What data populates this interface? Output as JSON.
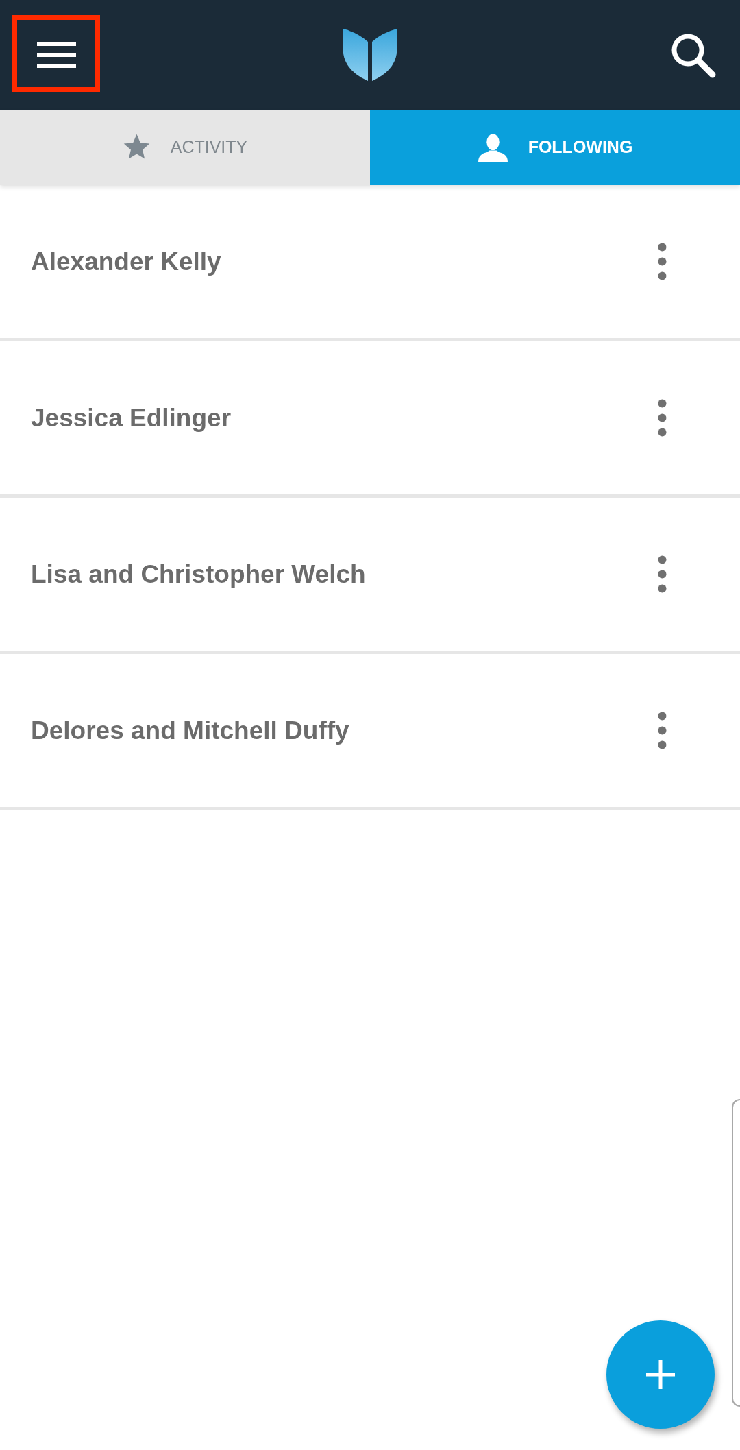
{
  "header": {
    "menu_button": {
      "highlighted": true
    }
  },
  "tabs": [
    {
      "label": "ACTIVITY",
      "selected": false
    },
    {
      "label": "FOLLOWING",
      "selected": true
    }
  ],
  "following": [
    {
      "name": "Alexander Kelly"
    },
    {
      "name": "Jessica Edlinger"
    },
    {
      "name": "Lisa and Christopher Welch"
    },
    {
      "name": "Delores and Mitchell Duffy"
    }
  ]
}
